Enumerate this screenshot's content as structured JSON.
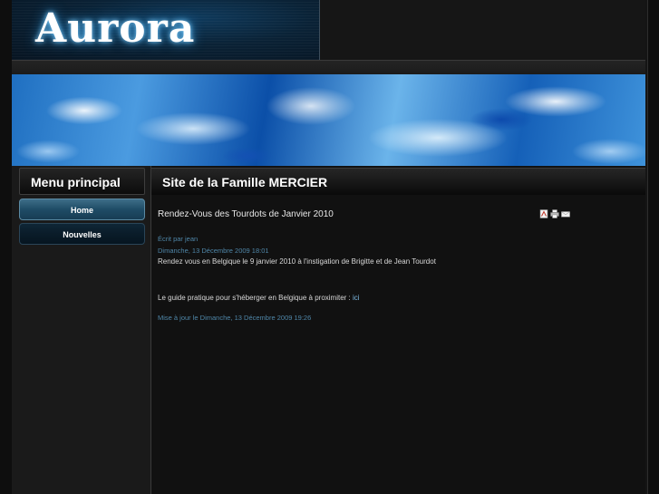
{
  "header": {
    "logo_text": "Aurora"
  },
  "sidebar": {
    "heading": "Menu principal",
    "items": [
      {
        "label": "Home",
        "active": true
      },
      {
        "label": "Nouvelles",
        "active": false
      }
    ]
  },
  "main": {
    "heading": "Site de la Famille MERCIER",
    "article": {
      "title": "Rendez-Vous des Tourdots de Janvier 2010",
      "icons": [
        "pdf-icon",
        "print-icon",
        "email-icon"
      ],
      "author": "Écrit par jean",
      "created": "Dimanche, 13 Décembre 2009 18:01",
      "paragraph1": "Rendez vous en Belgique le 9 janvier 2010 à l'instigation de Brigitte et de Jean Tourdot",
      "paragraph2_prefix": "Le guide pratique pour s'héberger en Belgique à proximiter : ",
      "paragraph2_link": "ici",
      "modified": "Mise à jour le Dimanche, 13 Décembre 2009 19:26"
    }
  },
  "colors": {
    "accent": "#4f86a8",
    "menu_active": "#1f4c66",
    "menu_inactive": "#0a1c29",
    "background": "#111111"
  }
}
